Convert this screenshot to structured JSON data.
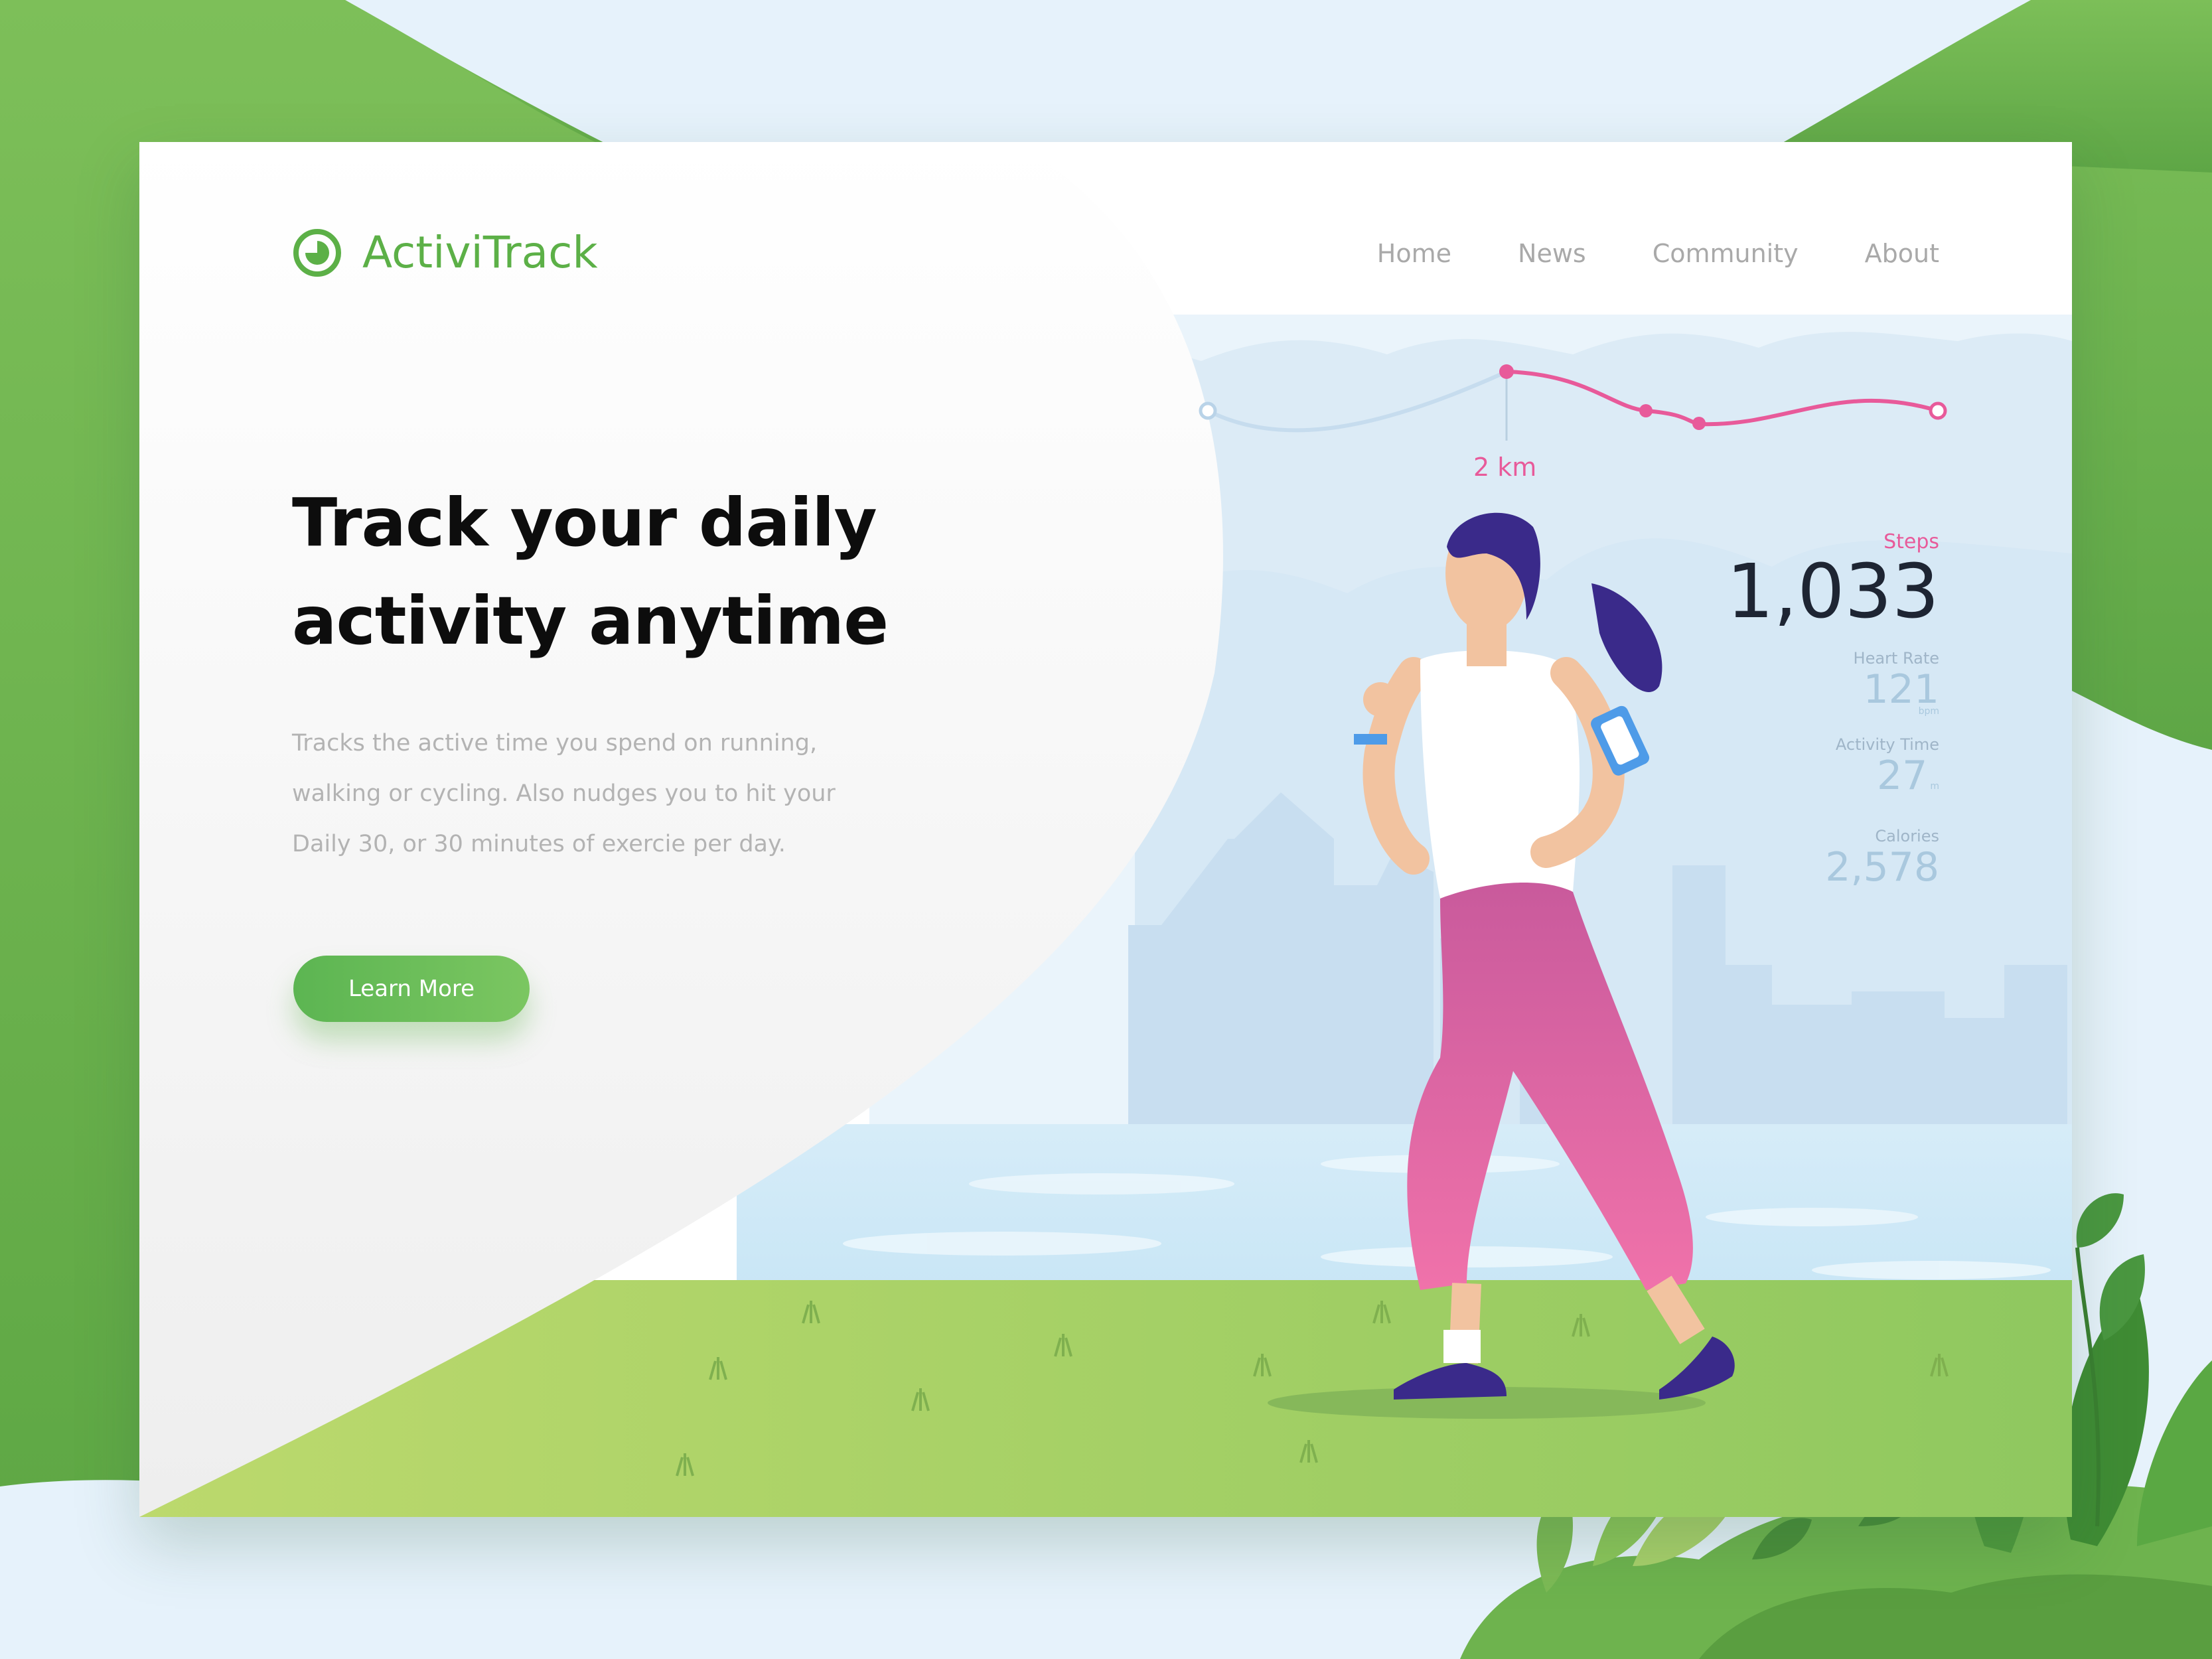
{
  "brand": {
    "name": "ActiviTrack",
    "accent": "#5cb047"
  },
  "nav": {
    "items": [
      "Home",
      "News",
      "Community",
      "About"
    ]
  },
  "hero": {
    "headline_line1": "Track your daily",
    "headline_line2": "activity anytime",
    "description_line1": "Tracks the active time you spend on running,",
    "description_line2": "walking or cycling. Also nudges you to hit your",
    "description_line3": "Daily 30, or 30 minutes of exercie per day.",
    "cta_label": "Learn More"
  },
  "route": {
    "distance_label": "2 km"
  },
  "stats": {
    "steps": {
      "label": "Steps",
      "value": "1,033"
    },
    "heart_rate": {
      "label": "Heart Rate",
      "value": "121",
      "unit": "bpm"
    },
    "activity_time": {
      "label": "Activity Time",
      "value": "27",
      "unit": "m"
    },
    "calories": {
      "label": "Calories",
      "value": "2,578"
    }
  },
  "colors": {
    "green": "#5cb047",
    "pink": "#e85a9a",
    "sky": "#e6f2fb",
    "dark_text": "#0d0d0d"
  },
  "icons": [
    "activity-ring-icon"
  ]
}
